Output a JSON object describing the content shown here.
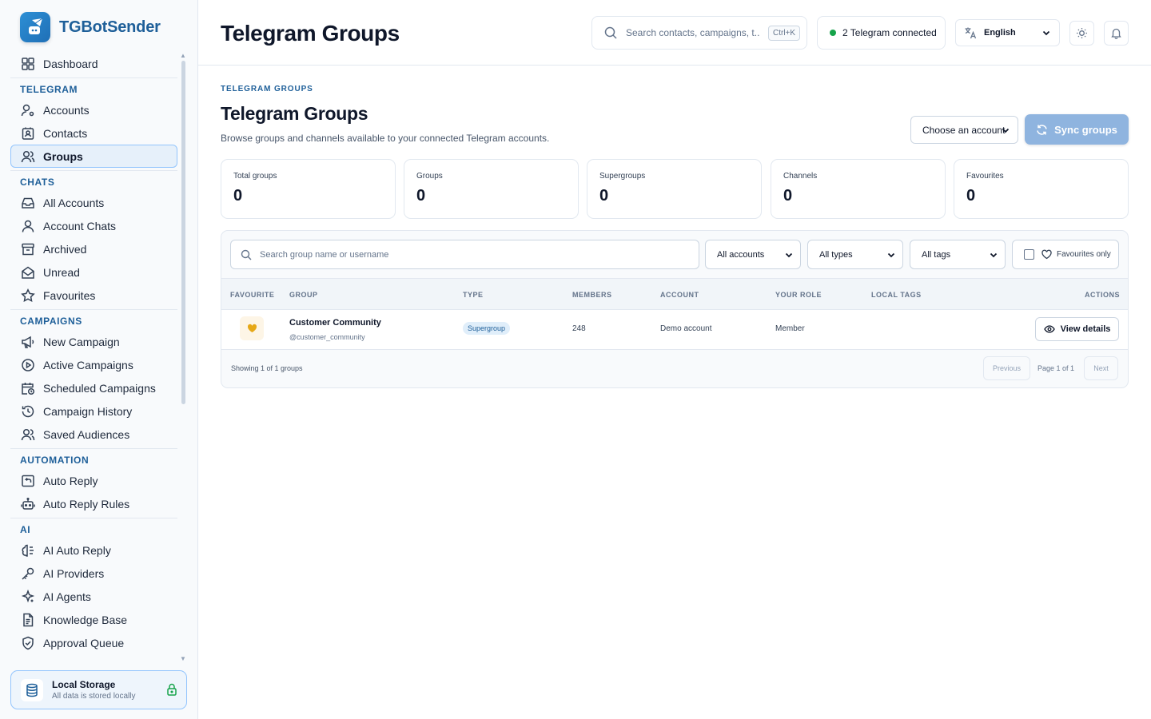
{
  "app": {
    "name": "TGBotSender"
  },
  "sidebar": {
    "dashboard": "Dashboard",
    "sections": [
      {
        "title": "TELEGRAM",
        "items": [
          {
            "label": "Accounts",
            "icon": "user-cog-icon"
          },
          {
            "label": "Contacts",
            "icon": "contact-card-icon"
          },
          {
            "label": "Groups",
            "icon": "users-icon",
            "active": true
          }
        ]
      },
      {
        "title": "CHATS",
        "items": [
          {
            "label": "All Accounts",
            "icon": "inbox-icon"
          },
          {
            "label": "Account Chats",
            "icon": "user-icon"
          },
          {
            "label": "Archived",
            "icon": "archive-icon"
          },
          {
            "label": "Unread",
            "icon": "mail-open-icon"
          },
          {
            "label": "Favourites",
            "icon": "star-icon"
          }
        ]
      },
      {
        "title": "CAMPAIGNS",
        "items": [
          {
            "label": "New Campaign",
            "icon": "megaphone-icon"
          },
          {
            "label": "Active Campaigns",
            "icon": "play-circle-icon"
          },
          {
            "label": "Scheduled Campaigns",
            "icon": "calendar-clock-icon"
          },
          {
            "label": "Campaign History",
            "icon": "history-icon"
          },
          {
            "label": "Saved Audiences",
            "icon": "users-icon"
          }
        ]
      },
      {
        "title": "AUTOMATION",
        "items": [
          {
            "label": "Auto Reply",
            "icon": "reply-icon"
          },
          {
            "label": "Auto Reply Rules",
            "icon": "bot-icon"
          }
        ]
      },
      {
        "title": "AI",
        "items": [
          {
            "label": "AI Auto Reply",
            "icon": "ai-brain-icon"
          },
          {
            "label": "AI Providers",
            "icon": "key-icon"
          },
          {
            "label": "AI Agents",
            "icon": "sparkles-icon"
          },
          {
            "label": "Knowledge Base",
            "icon": "document-icon"
          },
          {
            "label": "Approval Queue",
            "icon": "shield-check-icon"
          }
        ]
      }
    ],
    "storage": {
      "title": "Local Storage",
      "subtitle": "All data is stored locally"
    }
  },
  "topbar": {
    "title": "Telegram Groups",
    "search_placeholder": "Search contacts, campaigns, t...",
    "search_shortcut": "Ctrl+K",
    "telegram_status": "2 Telegram connected",
    "language": "English"
  },
  "main": {
    "eyebrow": "TELEGRAM GROUPS",
    "heading": "Telegram Groups",
    "subtitle": "Browse groups and channels available to your connected Telegram accounts.",
    "account_select": "Choose an account",
    "sync_button": "Sync groups",
    "stats": [
      {
        "label": "Total groups",
        "value": "0"
      },
      {
        "label": "Groups",
        "value": "0"
      },
      {
        "label": "Supergroups",
        "value": "0"
      },
      {
        "label": "Channels",
        "value": "0"
      },
      {
        "label": "Favourites",
        "value": "0"
      }
    ],
    "filters": {
      "search_placeholder": "Search group name or username",
      "accounts": "All accounts",
      "types": "All types",
      "tags": "All tags",
      "favourites_only": "Favourites only"
    },
    "table": {
      "columns": [
        "FAVOURITE",
        "GROUP",
        "TYPE",
        "MEMBERS",
        "ACCOUNT",
        "YOUR ROLE",
        "LOCAL TAGS",
        "ACTIONS"
      ],
      "rows": [
        {
          "name": "Customer Community",
          "username": "@customer_community",
          "type": "Supergroup",
          "members": "248",
          "account": "Demo account",
          "role": "Member",
          "tags": "",
          "action": "View details"
        }
      ],
      "showing": "Showing 1 of 1 groups",
      "previous": "Previous",
      "page_info": "Page 1 of 1",
      "next": "Next"
    }
  },
  "colors": {
    "accent": "#1e5f99",
    "active_bg": "#e6f0fa",
    "sync_button": "#8fb4df",
    "status_dot": "#16a34a",
    "favourite_heart": "#e6a817"
  }
}
